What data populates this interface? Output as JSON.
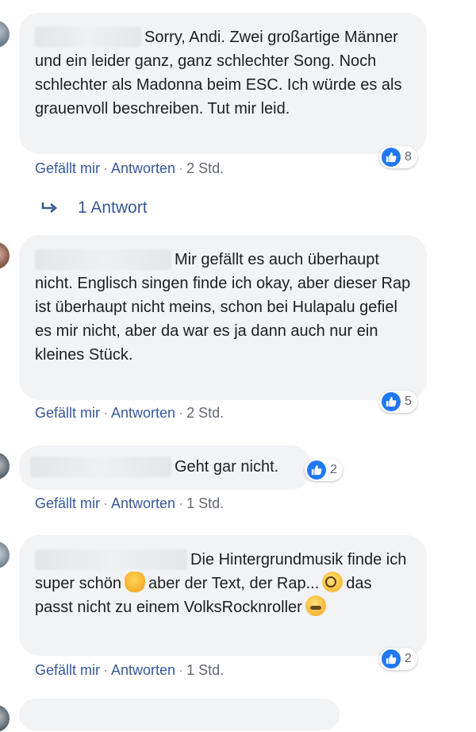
{
  "comments": [
    {
      "text": "Sorry, Andi. Zwei großartige Männer und ein leider ganz, ganz schlechter Song. Noch schlechter als Madonna beim ESC. Ich würde es als grauenvoll beschreiben. Tut mir leid.",
      "likes": "8",
      "like_label": "Gefällt mir",
      "reply_label": "Antworten",
      "time": "2 Std."
    },
    {
      "text": "Mir gefällt es auch überhaupt nicht. Englisch singen finde ich okay, aber dieser Rap ist überhaupt nicht meins, schon bei Hulapalu gefiel es mir nicht, aber da war es ja dann auch nur ein kleines Stück.",
      "likes": "5",
      "like_label": "Gefällt mir",
      "reply_label": "Antworten",
      "time": "2 Std."
    },
    {
      "text": "Geht gar nicht.",
      "likes": "2",
      "like_label": "Gefällt mir",
      "reply_label": "Antworten",
      "time": "1 Std."
    },
    {
      "text_part1": "Die Hintergrundmusik finde ich super schön",
      "text_part2": "aber der Text, der Rap...",
      "text_part3": "das passt nicht zu einem VolksRocknroller",
      "likes": "2",
      "like_label": "Gefällt mir",
      "reply_label": "Antworten",
      "time": "1 Std."
    }
  ],
  "replies_link": "1 Antwort",
  "separator": "·",
  "icons": {
    "like": "thumbs-up-icon",
    "reply": "reply-arrow-icon",
    "emoji_1": "ok-hand-emoji",
    "emoji_2": "dizzy-face-emoji",
    "emoji_3": "sleepy-face-emoji"
  },
  "colors": {
    "bubble": "#f2f3f5",
    "link": "#385898",
    "like_blue": "#2078f4",
    "meta_gray": "#616770"
  }
}
